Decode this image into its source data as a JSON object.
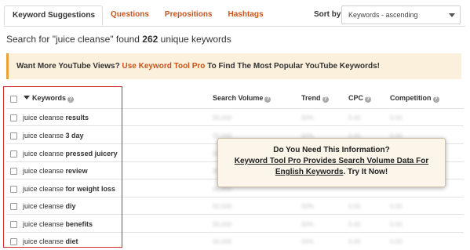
{
  "tabs": [
    {
      "label": "Keyword Suggestions",
      "active": true
    },
    {
      "label": "Questions",
      "active": false
    },
    {
      "label": "Prepositions",
      "active": false
    },
    {
      "label": "Hashtags",
      "active": false
    }
  ],
  "sort": {
    "label": "Sort by",
    "value": "Keywords - ascending"
  },
  "summary": {
    "prefix": "Search for \"juice cleanse\" found ",
    "count": "262",
    "suffix": " unique keywords"
  },
  "banner": {
    "before": "Want More YouTube Views? ",
    "link": "Use Keyword Tool Pro",
    "after": " To Find The Most Popular YouTube Keywords!"
  },
  "table": {
    "columns": {
      "keywords": "Keywords",
      "search_volume": "Search Volume",
      "trend": "Trend",
      "cpc": "CPC",
      "competition": "Competition"
    },
    "rows": [
      {
        "seed": "juice cleanse ",
        "modifier": "results"
      },
      {
        "seed": "juice cleanse ",
        "modifier": "3 day"
      },
      {
        "seed": "juice cleanse ",
        "modifier": "pressed juicery"
      },
      {
        "seed": "juice cleanse ",
        "modifier": "review"
      },
      {
        "seed": "juice cleanse ",
        "modifier": "for weight loss"
      },
      {
        "seed": "juice cleanse ",
        "modifier": "diy"
      },
      {
        "seed": "juice cleanse ",
        "modifier": "benefits"
      },
      {
        "seed": "juice cleanse ",
        "modifier": "diet"
      }
    ]
  },
  "overlay": {
    "title": "Do You Need This Information?",
    "line2": "Keyword Tool Pro Provides Search Volume Data For",
    "line3_link": "English Keywords",
    "line3_after": ". Try It Now!"
  },
  "icons": {
    "help": "question-mark-icon",
    "sort": "sort-descending-triangle-icon",
    "dropdown": "chevron-down-icon"
  },
  "colors": {
    "accent": "#c9531b",
    "banner_bg": "#fbf0dc",
    "banner_border": "#e8a23a",
    "highlight": "#d62b2b"
  }
}
